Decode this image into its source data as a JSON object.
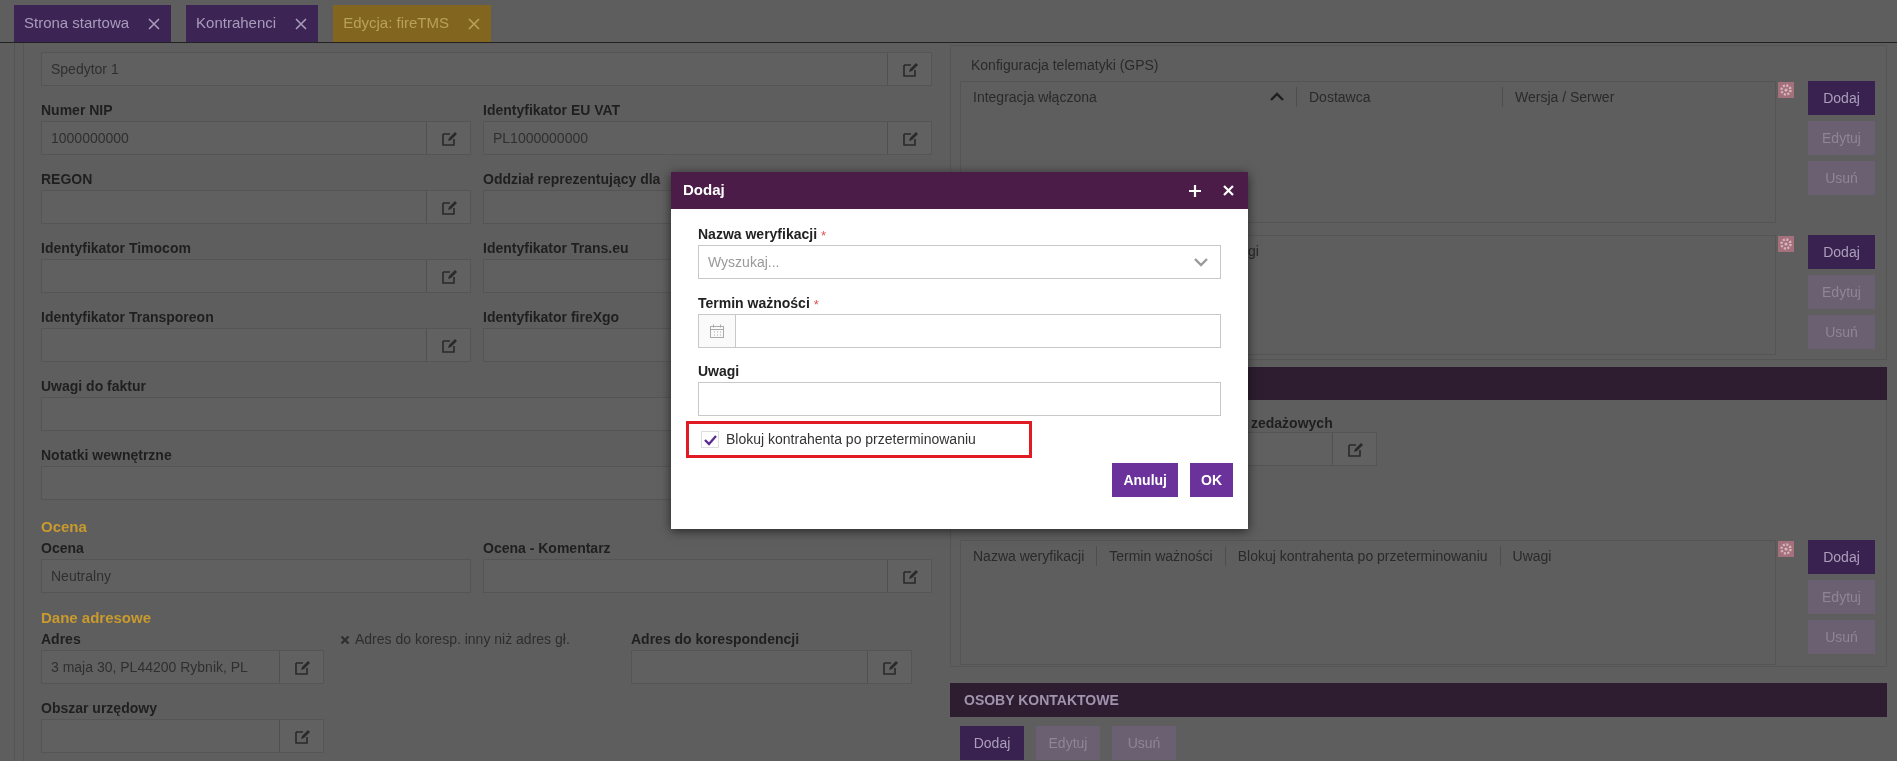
{
  "tabs": [
    {
      "label": "Strona startowa",
      "selected": false
    },
    {
      "label": "Kontrahenci",
      "selected": false
    },
    {
      "label": "Edycja: fireTMS",
      "selected": true
    }
  ],
  "left_form": [
    {
      "kind": "full",
      "fields": [
        {
          "value": "Spedytor 1",
          "edit": true
        }
      ]
    },
    {
      "kind": "pair",
      "fields": [
        {
          "label": "Numer NIP",
          "value": "1000000000",
          "edit": true
        },
        {
          "label": "Identyfikator EU VAT",
          "value": "PL1000000000",
          "edit": true
        }
      ]
    },
    {
      "kind": "pair",
      "fields": [
        {
          "label": "REGON",
          "edit": true
        },
        {
          "label": "Oddział reprezentujący dla"
        }
      ]
    },
    {
      "kind": "pair",
      "fields": [
        {
          "label": "Identyfikator Timocom",
          "edit": true
        },
        {
          "label": "Identyfikator Trans.eu"
        }
      ]
    },
    {
      "kind": "pair",
      "fields": [
        {
          "label": "Identyfikator Transporeon",
          "edit": true
        },
        {
          "label": "Identyfikator fireXgo"
        }
      ]
    },
    {
      "kind": "full",
      "fields": [
        {
          "label": "Uwagi do faktur"
        }
      ]
    },
    {
      "kind": "full",
      "fields": [
        {
          "label": "Notatki wewnętrzne"
        }
      ]
    },
    {
      "kind": "section",
      "title": "Ocena"
    },
    {
      "kind": "pair",
      "fields": [
        {
          "label": "Ocena",
          "value": "Neutralny",
          "edit": false
        },
        {
          "label": "Ocena - Komentarz",
          "edit": true
        }
      ]
    },
    {
      "kind": "section",
      "title": "Dane adresowe"
    },
    {
      "kind": "address",
      "fields": [
        {
          "label": "Adres",
          "value": "3 maja 30, PL44200 Rybnik, PL",
          "edit": true
        },
        {
          "note": "Adres do koresp. inny niż adres gł."
        },
        {
          "label": "Adres do korespondencji",
          "edit": true
        }
      ]
    },
    {
      "kind": "narrow",
      "fields": [
        {
          "label": "Obszar urzędowy",
          "edit": true
        }
      ]
    }
  ],
  "gps": {
    "title": "Konfiguracja telematyki (GPS)",
    "columns": [
      {
        "label": "Integracja włączona",
        "sorted": true
      },
      {
        "label": "Dostawca",
        "sorted": false
      },
      {
        "label": "Wersja / Serwer",
        "sorted": false
      }
    ],
    "buttons": [
      {
        "label": "Dodaj",
        "disabled": false
      },
      {
        "label": "Edytuj",
        "disabled": true
      },
      {
        "label": "Usuń",
        "disabled": true
      }
    ]
  },
  "second_table": {
    "columns": [
      {
        "label": "gi",
        "sorted": false
      }
    ],
    "buttons": [
      {
        "label": "Dodaj",
        "disabled": false
      },
      {
        "label": "Edytuj",
        "disabled": true
      },
      {
        "label": "Usuń",
        "disabled": true
      }
    ]
  },
  "sales_field": {
    "label": "zedażowych",
    "edit": true
  },
  "verification_table": {
    "columns": [
      {
        "label": "Nazwa weryfikacji",
        "sorted": false
      },
      {
        "label": "Termin ważności",
        "sorted": false
      },
      {
        "label": "Blokuj kontrahenta po przeterminowaniu",
        "sorted": false
      },
      {
        "label": "Uwagi",
        "sorted": false
      }
    ],
    "buttons": [
      {
        "label": "Dodaj",
        "disabled": false
      },
      {
        "label": "Edytuj",
        "disabled": true
      },
      {
        "label": "Usuń",
        "disabled": true
      }
    ]
  },
  "contacts": {
    "title": "OSOBY KONTAKTOWE",
    "buttons": [
      {
        "label": "Dodaj",
        "disabled": false
      },
      {
        "label": "Edytuj",
        "disabled": true
      },
      {
        "label": "Usuń",
        "disabled": true
      }
    ]
  },
  "dialog": {
    "title": "Dodaj",
    "fields": [
      {
        "label": "Nazwa weryfikacji",
        "required_mark": "*",
        "kind": "select",
        "placeholder": "Wyszukaj..."
      },
      {
        "label": "Termin ważności",
        "required_mark": "*",
        "kind": "date"
      },
      {
        "label": "Uwagi",
        "kind": "text"
      }
    ],
    "checkbox": {
      "label": "Blokuj kontrahenta po przeterminowaniu",
      "checked": true,
      "highlighted": true
    },
    "buttons": [
      "Anuluj",
      "OK"
    ]
  }
}
